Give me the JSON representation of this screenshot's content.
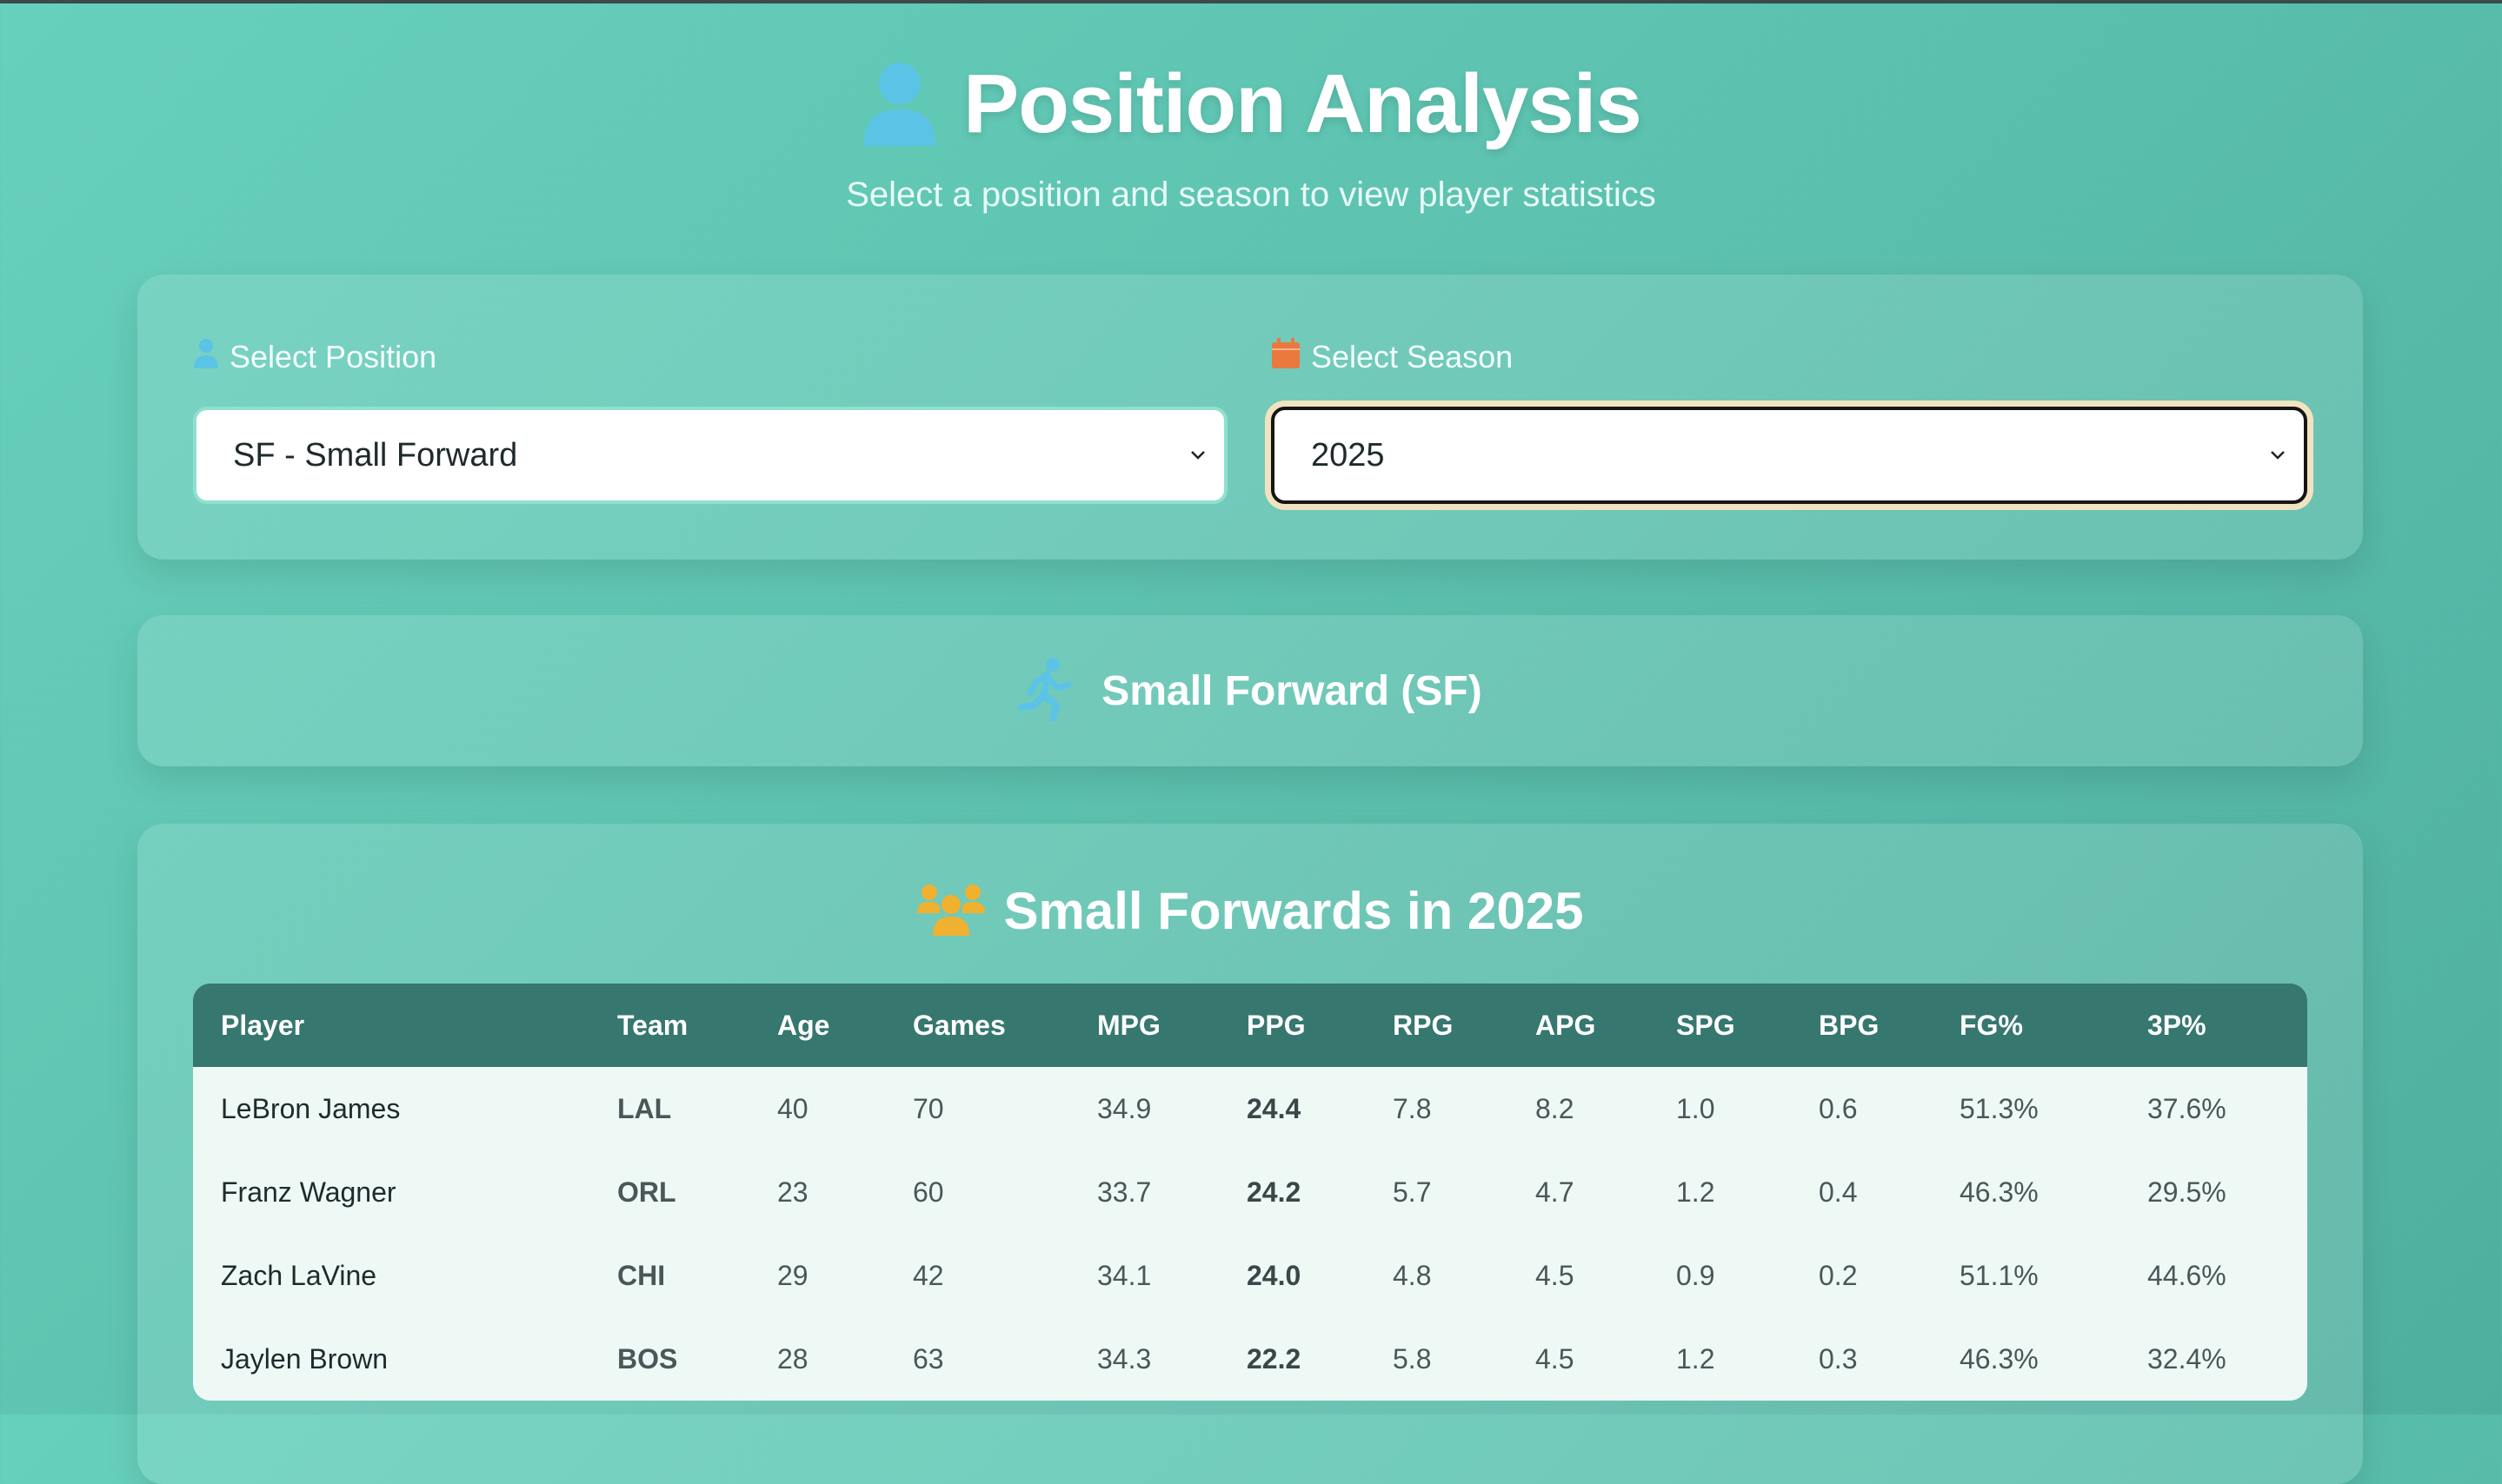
{
  "header": {
    "title": "Position Analysis",
    "subtitle": "Select a position and season to view player statistics",
    "title_icon": "user-icon"
  },
  "selectors": {
    "position": {
      "label": "Select Position",
      "icon": "user-icon",
      "value": "SF - Small Forward"
    },
    "season": {
      "label": "Select Season",
      "icon": "calendar-icon",
      "value": "2025"
    }
  },
  "banner": {
    "icon": "running-icon",
    "text": "Small Forward (SF)"
  },
  "players": {
    "icon": "users-icon",
    "title": "Small Forwards in 2025",
    "columns": [
      "Player",
      "Team",
      "Age",
      "Games",
      "MPG",
      "PPG",
      "RPG",
      "APG",
      "SPG",
      "BPG",
      "FG%",
      "3P%"
    ],
    "rows": [
      [
        "LeBron James",
        "LAL",
        "40",
        "70",
        "34.9",
        "24.4",
        "7.8",
        "8.2",
        "1.0",
        "0.6",
        "51.3%",
        "37.6%"
      ],
      [
        "Franz Wagner",
        "ORL",
        "23",
        "60",
        "33.7",
        "24.2",
        "5.7",
        "4.7",
        "1.2",
        "0.4",
        "46.3%",
        "29.5%"
      ],
      [
        "Zach LaVine",
        "CHI",
        "29",
        "42",
        "34.1",
        "24.0",
        "4.8",
        "4.5",
        "0.9",
        "0.2",
        "51.1%",
        "44.6%"
      ],
      [
        "Jaylen Brown",
        "BOS",
        "28",
        "63",
        "34.3",
        "22.2",
        "5.8",
        "4.5",
        "1.2",
        "0.3",
        "46.3%",
        "32.4%"
      ]
    ]
  },
  "colors": {
    "background": "#5ec4b1",
    "table_header": "#36776f",
    "user_icon": "#5bc4e6",
    "calendar_icon": "#e9793d",
    "users_icon": "#f0b030"
  }
}
